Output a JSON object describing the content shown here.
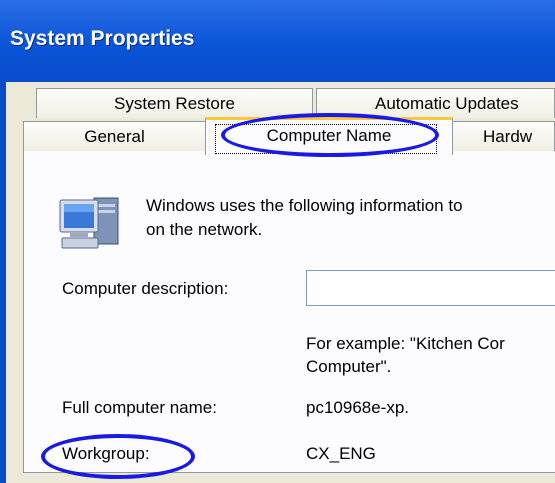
{
  "window": {
    "title": "System Properties"
  },
  "tabs": {
    "back_row": [
      "System Restore",
      "Automatic Updates"
    ],
    "front_row": [
      "General",
      "Computer Name",
      "Hardw"
    ],
    "active": "Computer Name"
  },
  "panel": {
    "info_line1": "Windows uses the following information to",
    "info_line2": "on the network.",
    "description_label": "Computer description:",
    "description_value": "",
    "example_line1": "For example: \"Kitchen Cor",
    "example_line2": "Computer\".",
    "full_name_label": "Full computer name:",
    "full_name_value": "pc10968e-xp.",
    "workgroup_label": "Workgroup:",
    "workgroup_value": "CX_ENG"
  },
  "annotation_color": "#1a1ae6",
  "icons": {
    "computer": "computer-icon"
  }
}
